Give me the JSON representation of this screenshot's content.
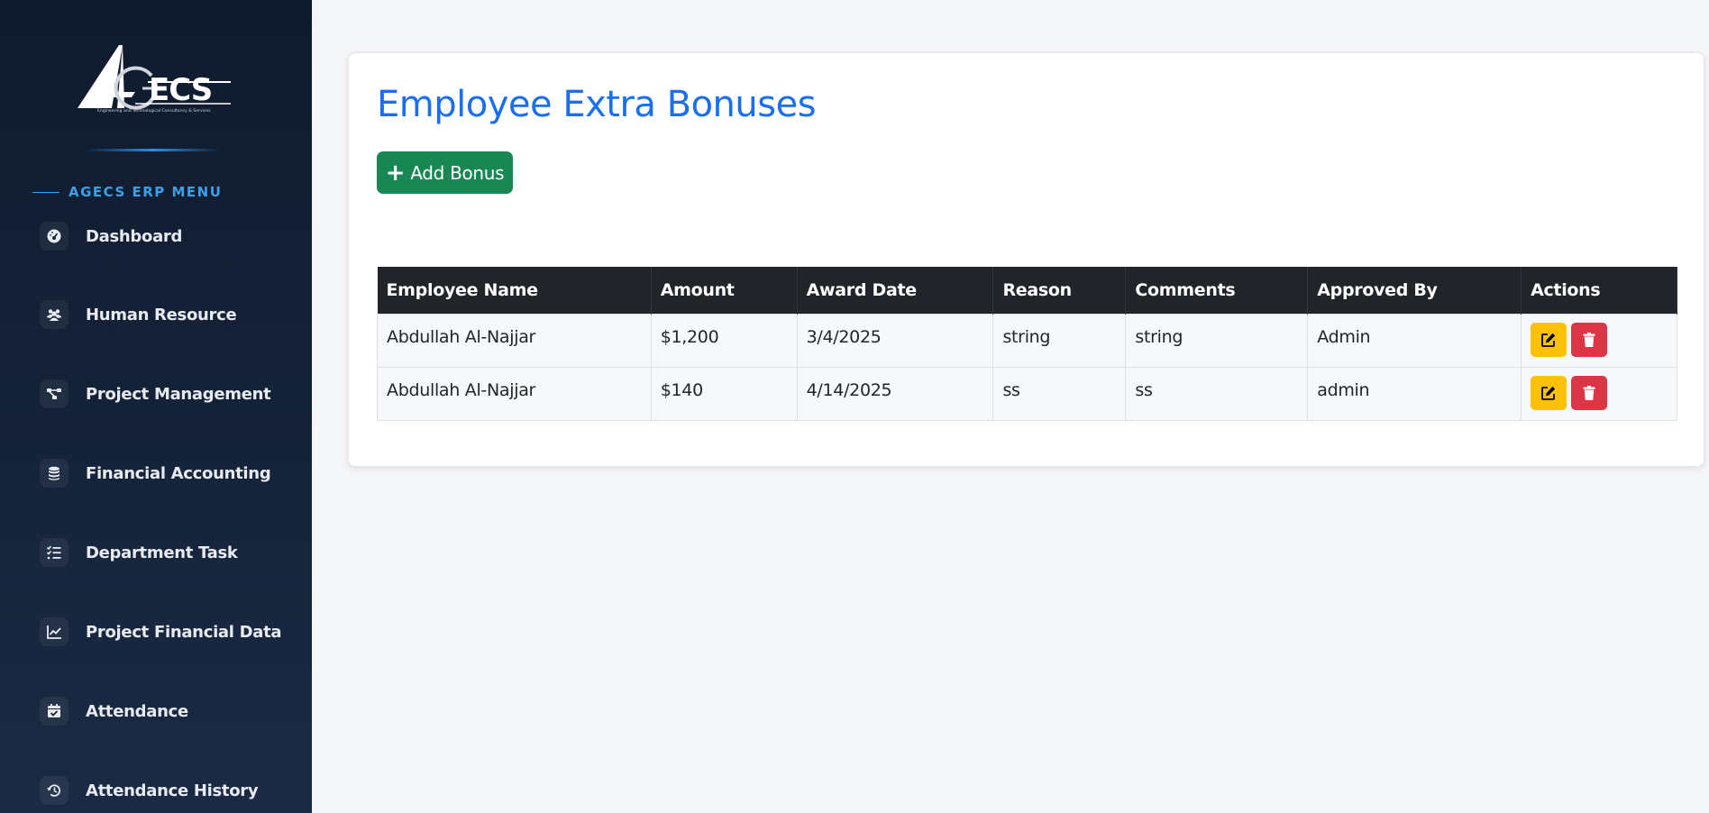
{
  "sidebar": {
    "logo_text": "AGECS",
    "logo_tagline": "Engineering and Technological Consultancy & Services",
    "menu_heading": "AGECS ERP MENU",
    "items": [
      {
        "label": "Dashboard",
        "icon": "gauge-icon"
      },
      {
        "label": "Human Resource",
        "icon": "users-icon"
      },
      {
        "label": "Project Management",
        "icon": "project-diagram-icon"
      },
      {
        "label": "Financial Accounting",
        "icon": "coins-icon"
      },
      {
        "label": "Department Task",
        "icon": "tasks-icon"
      },
      {
        "label": "Project Financial Data",
        "icon": "line-chart-icon"
      },
      {
        "label": "Attendance",
        "icon": "calendar-check-icon"
      },
      {
        "label": "Attendance History",
        "icon": "history-icon"
      }
    ]
  },
  "main": {
    "title": "Employee Extra Bonuses",
    "add_button": "Add Bonus",
    "table": {
      "columns": [
        "Employee Name",
        "Amount",
        "Award Date",
        "Reason",
        "Comments",
        "Approved By",
        "Actions"
      ],
      "rows": [
        {
          "employee_name": "Abdullah Al-Najjar",
          "amount": "$1,200",
          "award_date": "3/4/2025",
          "reason": "string",
          "comments": "string",
          "approved_by": "Admin"
        },
        {
          "employee_name": "Abdullah Al-Najjar",
          "amount": "$140",
          "award_date": "4/14/2025",
          "reason": "ss",
          "comments": "ss",
          "approved_by": "admin"
        }
      ]
    }
  },
  "colors": {
    "sidebar_bg": "#0f1a2d",
    "accent_blue": "#1a6ff0",
    "menu_heading": "#3aa0e8",
    "add_button": "#198754",
    "edit_button": "#ffc107",
    "delete_button": "#dc3545",
    "table_header": "#212529"
  }
}
